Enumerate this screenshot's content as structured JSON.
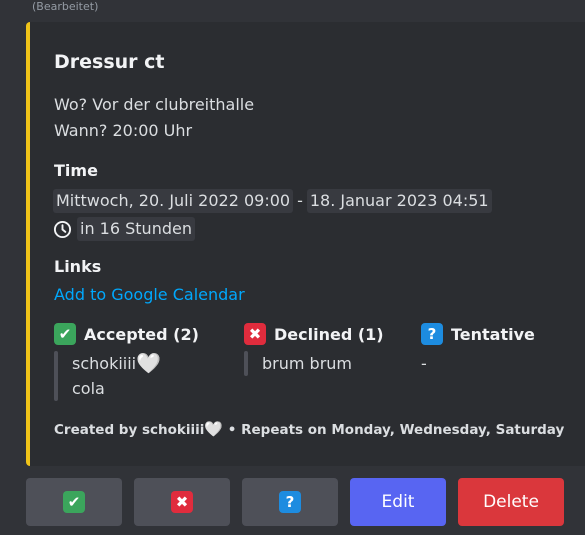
{
  "message": {
    "edited_label": "(Bearbeitet)"
  },
  "embed": {
    "accent_color": "#f0c419",
    "title": "Dressur ct",
    "description": [
      "Wo? Vor der clubreithalle",
      "Wann? 20:00 Uhr"
    ],
    "time": {
      "label": "Time",
      "start": "Mittwoch, 20. Juli 2022 09:00",
      "separator": "-",
      "end": "18. Januar 2023 04:51",
      "relative": "in 16 Stunden",
      "icon": "clock-icon"
    },
    "links": {
      "label": "Links",
      "google_calendar": "Add to Google Calendar"
    },
    "rsvp": {
      "accepted": {
        "icon": "check-mark-icon",
        "label": "Accepted (2)",
        "users": [
          "schokiiii",
          "cola"
        ],
        "user_icon": "white-heart-icon",
        "heart": "🤍"
      },
      "declined": {
        "icon": "cross-mark-icon",
        "label": "Declined (1)",
        "users": [
          "brum brum"
        ]
      },
      "tentative": {
        "icon": "question-mark-icon",
        "label": "Tentative",
        "empty_text": "-"
      }
    },
    "footer": {
      "created_by_prefix": "Created by schokiiii",
      "heart": "🤍",
      "repeats": "• Repeats on Monday, Wednesday, Saturday"
    }
  },
  "buttons": {
    "accept": {
      "icon": "check-mark-icon",
      "glyph": "✔"
    },
    "decline": {
      "icon": "cross-mark-icon",
      "glyph": "✖"
    },
    "tentative": {
      "icon": "question-mark-icon",
      "glyph": "?"
    },
    "edit": "Edit",
    "delete": "Delete"
  },
  "colors": {
    "background": "#313338",
    "embed_bg": "#2b2d31",
    "link": "#00a8fc",
    "blurple": "#5865f2",
    "danger": "#da373c",
    "grey_button": "#4e5058",
    "green": "#3ba55c",
    "red": "#e02c3d",
    "blue": "#1d8ce0"
  }
}
